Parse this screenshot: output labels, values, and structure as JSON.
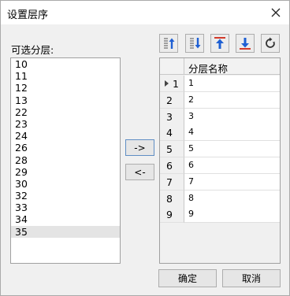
{
  "window": {
    "title": "设置层序"
  },
  "available": {
    "label": "可选分层:",
    "items": [
      "10",
      "11",
      "12",
      "13",
      "22",
      "23",
      "24",
      "26",
      "28",
      "29",
      "30",
      "32",
      "33",
      "34",
      "35"
    ],
    "selected": "35"
  },
  "buttons": {
    "add": "->",
    "remove": "<-",
    "ok": "确定",
    "cancel": "取消"
  },
  "toolbar": [
    "move-top-icon",
    "move-bottom-icon",
    "move-up-icon",
    "move-down-icon",
    "refresh-icon"
  ],
  "grid": {
    "header": "分层名称",
    "current_row": 1,
    "rows": [
      {
        "num": "1",
        "name": "1"
      },
      {
        "num": "2",
        "name": "2"
      },
      {
        "num": "3",
        "name": "3"
      },
      {
        "num": "4",
        "name": "4"
      },
      {
        "num": "5",
        "name": "5"
      },
      {
        "num": "6",
        "name": "6"
      },
      {
        "num": "7",
        "name": "7"
      },
      {
        "num": "8",
        "name": "8"
      },
      {
        "num": "9",
        "name": "9"
      }
    ]
  },
  "colors": {
    "accent_blue": "#1e5fd3",
    "accent_red": "#d23a2a"
  }
}
